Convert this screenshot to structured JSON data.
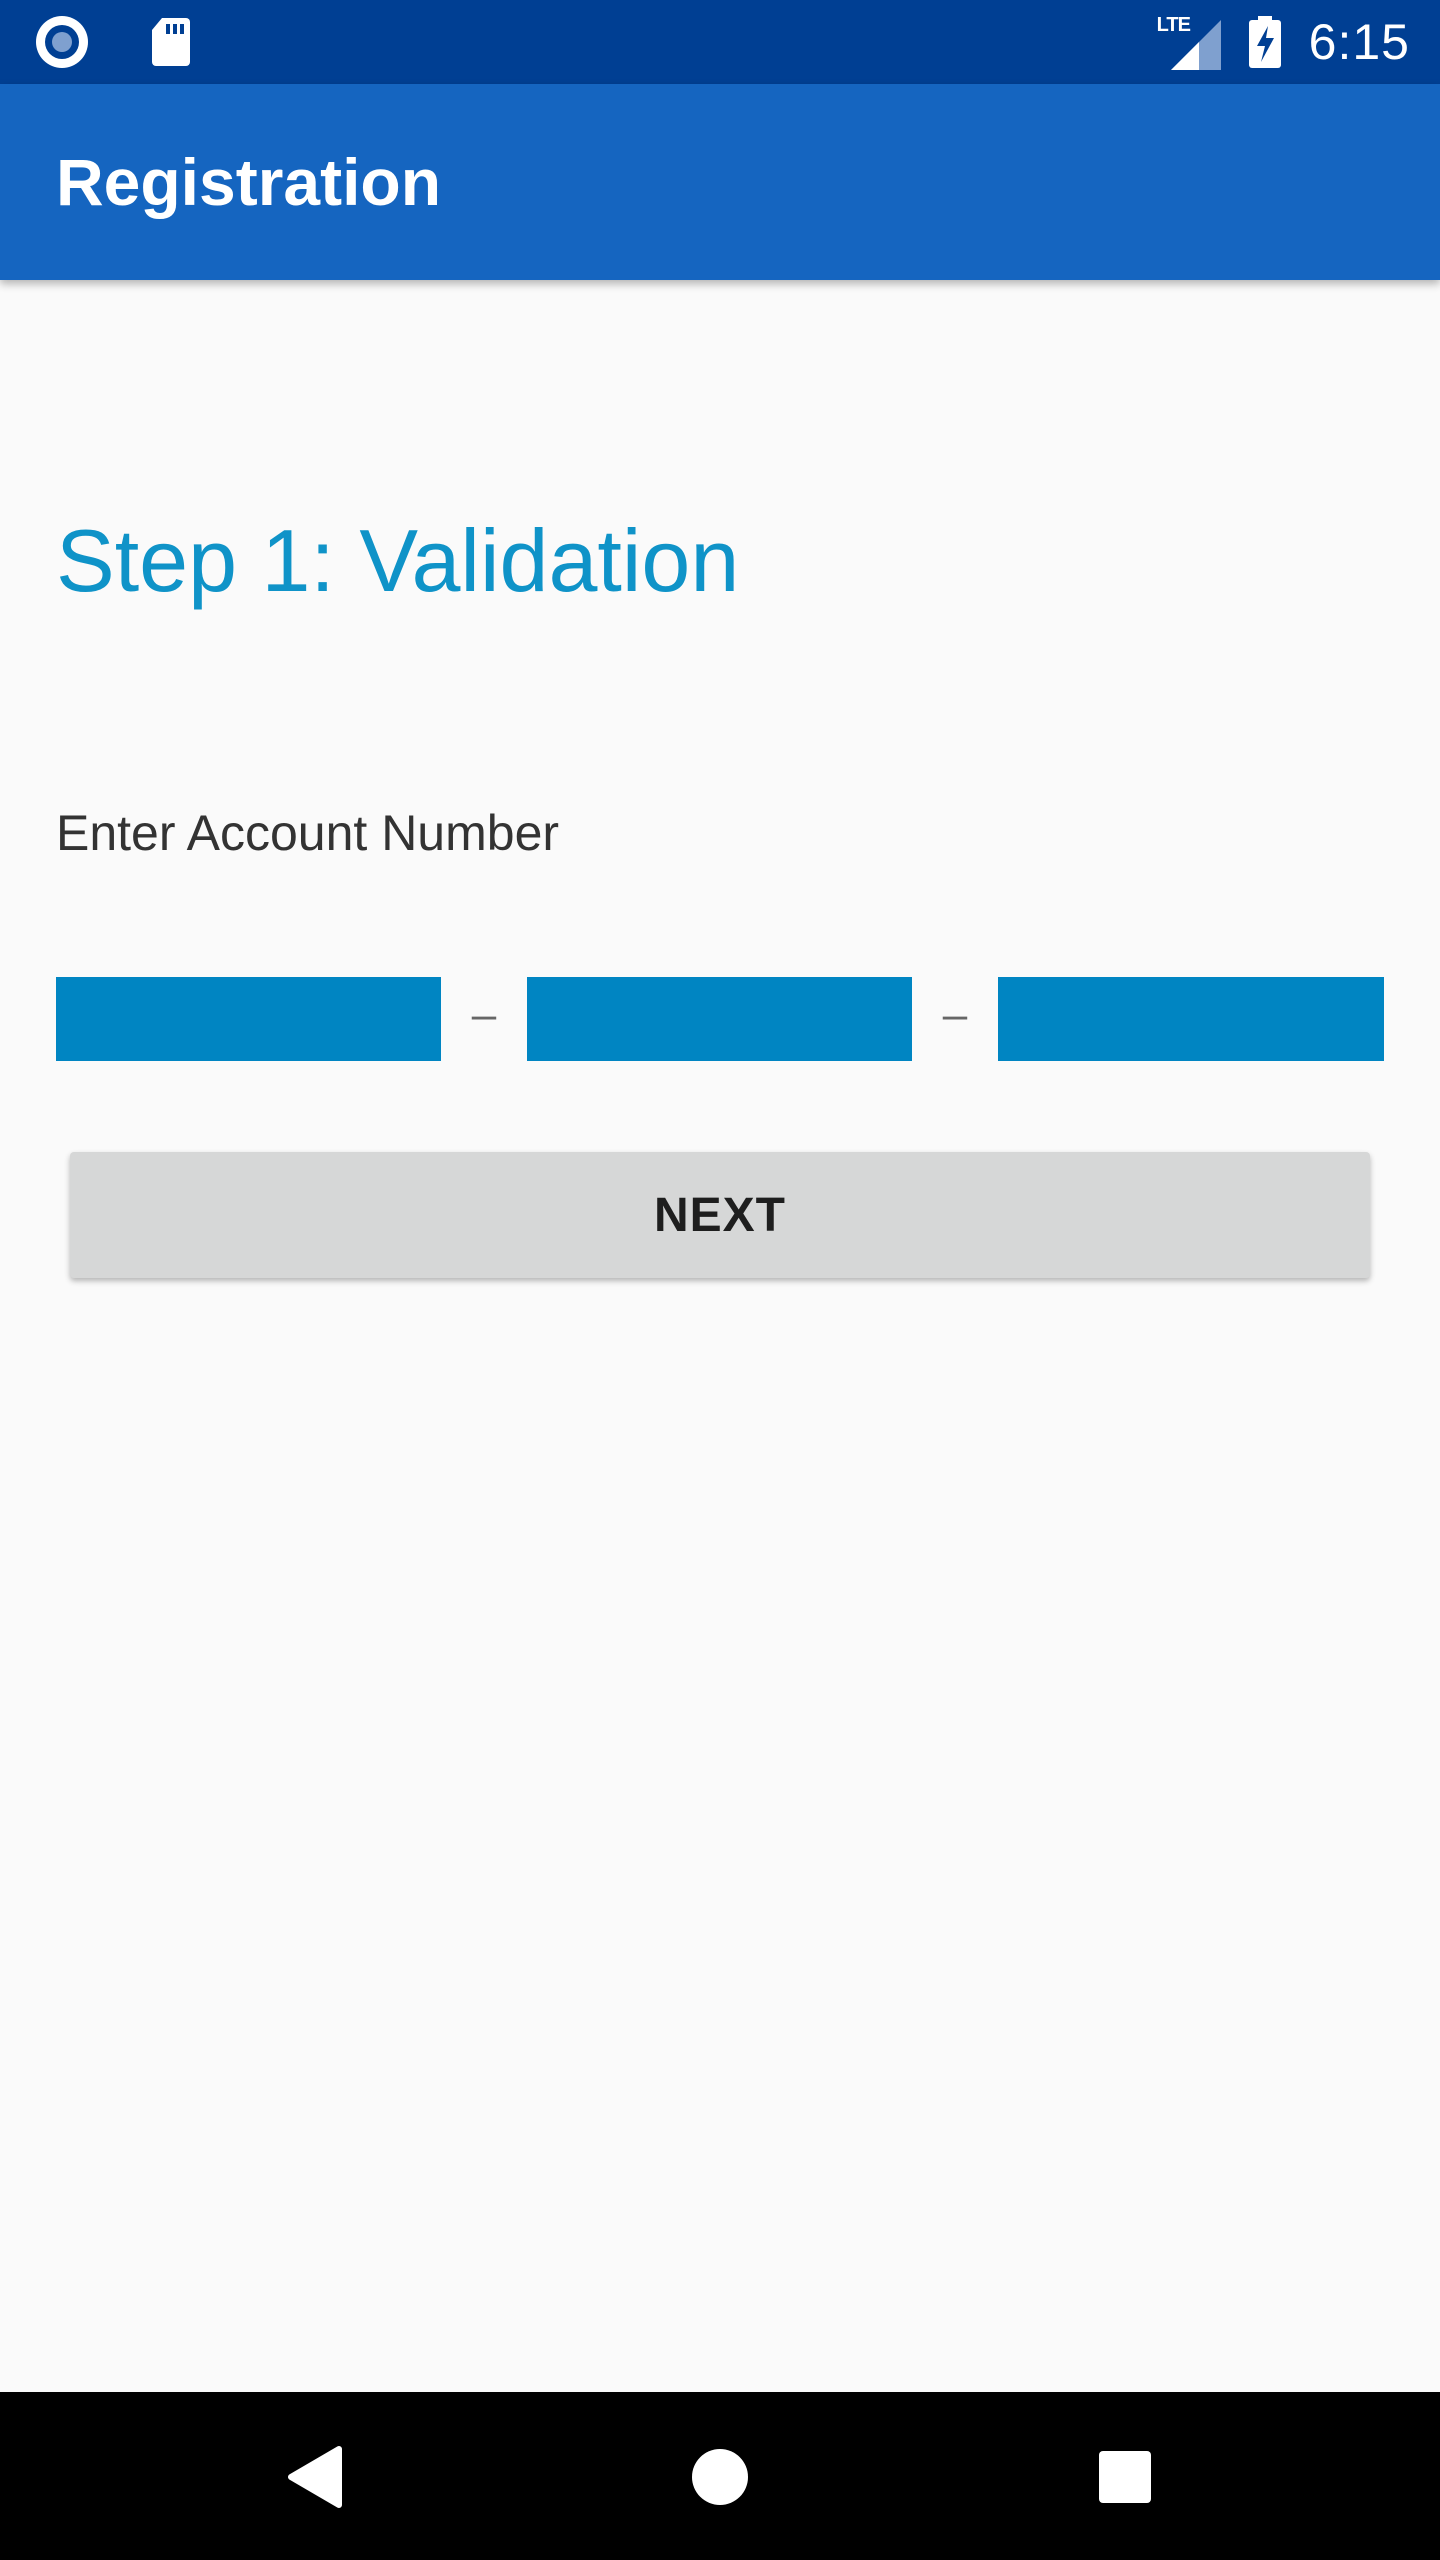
{
  "status_bar": {
    "time": "6:15",
    "network_label": "LTE",
    "icons": [
      "record-icon",
      "sd-card-icon",
      "lte-signal-icon",
      "battery-charging-icon"
    ]
  },
  "app_bar": {
    "title": "Registration"
  },
  "main": {
    "step_title": "Step 1: Validation",
    "account_label": "Enter Account Number",
    "account_fields": [
      {
        "value": ""
      },
      {
        "value": ""
      },
      {
        "value": ""
      }
    ],
    "separator": "–",
    "next_label": "NEXT"
  },
  "nav_bar": {
    "icons": [
      "back-icon",
      "home-icon",
      "recents-icon"
    ]
  },
  "colors": {
    "status_bar": "#003f93",
    "app_bar": "#1565c0",
    "accent_title": "#0f93c8",
    "field_fill": "#0085c2",
    "button_bg": "#d6d7d7",
    "background": "#fafafa"
  }
}
